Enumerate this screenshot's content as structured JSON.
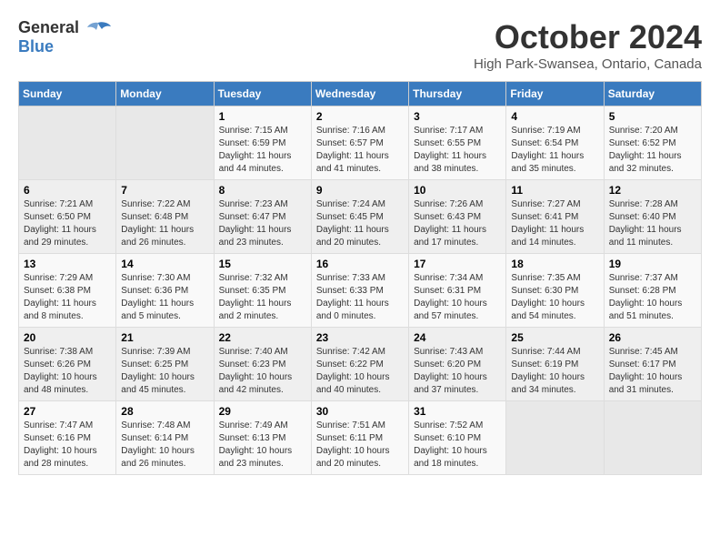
{
  "header": {
    "logo_general": "General",
    "logo_blue": "Blue",
    "month_title": "October 2024",
    "subtitle": "High Park-Swansea, Ontario, Canada"
  },
  "days_of_week": [
    "Sunday",
    "Monday",
    "Tuesday",
    "Wednesday",
    "Thursday",
    "Friday",
    "Saturday"
  ],
  "weeks": [
    [
      {
        "day": "",
        "info": ""
      },
      {
        "day": "",
        "info": ""
      },
      {
        "day": "1",
        "info": "Sunrise: 7:15 AM\nSunset: 6:59 PM\nDaylight: 11 hours and 44 minutes."
      },
      {
        "day": "2",
        "info": "Sunrise: 7:16 AM\nSunset: 6:57 PM\nDaylight: 11 hours and 41 minutes."
      },
      {
        "day": "3",
        "info": "Sunrise: 7:17 AM\nSunset: 6:55 PM\nDaylight: 11 hours and 38 minutes."
      },
      {
        "day": "4",
        "info": "Sunrise: 7:19 AM\nSunset: 6:54 PM\nDaylight: 11 hours and 35 minutes."
      },
      {
        "day": "5",
        "info": "Sunrise: 7:20 AM\nSunset: 6:52 PM\nDaylight: 11 hours and 32 minutes."
      }
    ],
    [
      {
        "day": "6",
        "info": "Sunrise: 7:21 AM\nSunset: 6:50 PM\nDaylight: 11 hours and 29 minutes."
      },
      {
        "day": "7",
        "info": "Sunrise: 7:22 AM\nSunset: 6:48 PM\nDaylight: 11 hours and 26 minutes."
      },
      {
        "day": "8",
        "info": "Sunrise: 7:23 AM\nSunset: 6:47 PM\nDaylight: 11 hours and 23 minutes."
      },
      {
        "day": "9",
        "info": "Sunrise: 7:24 AM\nSunset: 6:45 PM\nDaylight: 11 hours and 20 minutes."
      },
      {
        "day": "10",
        "info": "Sunrise: 7:26 AM\nSunset: 6:43 PM\nDaylight: 11 hours and 17 minutes."
      },
      {
        "day": "11",
        "info": "Sunrise: 7:27 AM\nSunset: 6:41 PM\nDaylight: 11 hours and 14 minutes."
      },
      {
        "day": "12",
        "info": "Sunrise: 7:28 AM\nSunset: 6:40 PM\nDaylight: 11 hours and 11 minutes."
      }
    ],
    [
      {
        "day": "13",
        "info": "Sunrise: 7:29 AM\nSunset: 6:38 PM\nDaylight: 11 hours and 8 minutes."
      },
      {
        "day": "14",
        "info": "Sunrise: 7:30 AM\nSunset: 6:36 PM\nDaylight: 11 hours and 5 minutes."
      },
      {
        "day": "15",
        "info": "Sunrise: 7:32 AM\nSunset: 6:35 PM\nDaylight: 11 hours and 2 minutes."
      },
      {
        "day": "16",
        "info": "Sunrise: 7:33 AM\nSunset: 6:33 PM\nDaylight: 11 hours and 0 minutes."
      },
      {
        "day": "17",
        "info": "Sunrise: 7:34 AM\nSunset: 6:31 PM\nDaylight: 10 hours and 57 minutes."
      },
      {
        "day": "18",
        "info": "Sunrise: 7:35 AM\nSunset: 6:30 PM\nDaylight: 10 hours and 54 minutes."
      },
      {
        "day": "19",
        "info": "Sunrise: 7:37 AM\nSunset: 6:28 PM\nDaylight: 10 hours and 51 minutes."
      }
    ],
    [
      {
        "day": "20",
        "info": "Sunrise: 7:38 AM\nSunset: 6:26 PM\nDaylight: 10 hours and 48 minutes."
      },
      {
        "day": "21",
        "info": "Sunrise: 7:39 AM\nSunset: 6:25 PM\nDaylight: 10 hours and 45 minutes."
      },
      {
        "day": "22",
        "info": "Sunrise: 7:40 AM\nSunset: 6:23 PM\nDaylight: 10 hours and 42 minutes."
      },
      {
        "day": "23",
        "info": "Sunrise: 7:42 AM\nSunset: 6:22 PM\nDaylight: 10 hours and 40 minutes."
      },
      {
        "day": "24",
        "info": "Sunrise: 7:43 AM\nSunset: 6:20 PM\nDaylight: 10 hours and 37 minutes."
      },
      {
        "day": "25",
        "info": "Sunrise: 7:44 AM\nSunset: 6:19 PM\nDaylight: 10 hours and 34 minutes."
      },
      {
        "day": "26",
        "info": "Sunrise: 7:45 AM\nSunset: 6:17 PM\nDaylight: 10 hours and 31 minutes."
      }
    ],
    [
      {
        "day": "27",
        "info": "Sunrise: 7:47 AM\nSunset: 6:16 PM\nDaylight: 10 hours and 28 minutes."
      },
      {
        "day": "28",
        "info": "Sunrise: 7:48 AM\nSunset: 6:14 PM\nDaylight: 10 hours and 26 minutes."
      },
      {
        "day": "29",
        "info": "Sunrise: 7:49 AM\nSunset: 6:13 PM\nDaylight: 10 hours and 23 minutes."
      },
      {
        "day": "30",
        "info": "Sunrise: 7:51 AM\nSunset: 6:11 PM\nDaylight: 10 hours and 20 minutes."
      },
      {
        "day": "31",
        "info": "Sunrise: 7:52 AM\nSunset: 6:10 PM\nDaylight: 10 hours and 18 minutes."
      },
      {
        "day": "",
        "info": ""
      },
      {
        "day": "",
        "info": ""
      }
    ]
  ]
}
